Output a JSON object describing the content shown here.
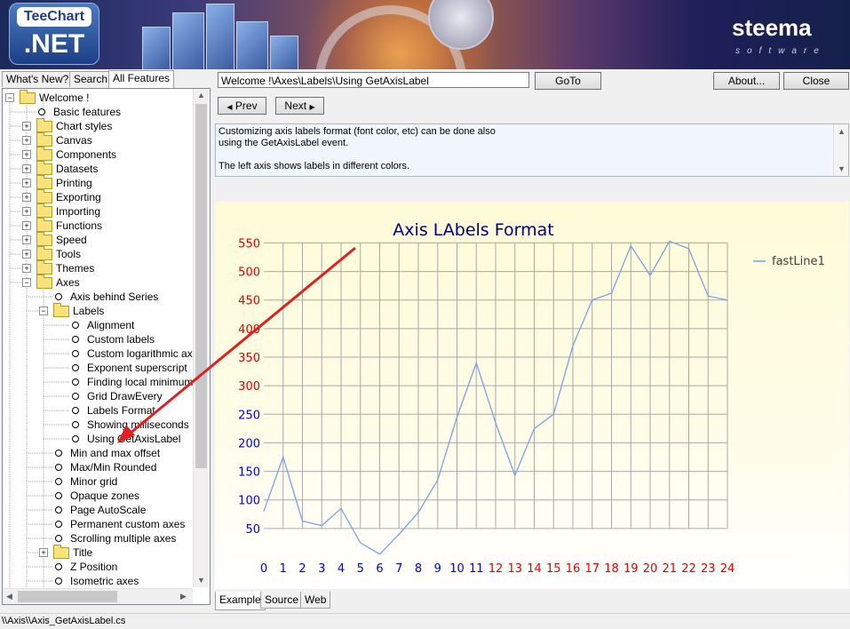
{
  "banner": {
    "logo_top": "TeeChart",
    "logo_bottom": ".NET",
    "brand": "steema",
    "brand_sub": "software"
  },
  "left_tabs": [
    "What's New?",
    "Search",
    "All Features"
  ],
  "tree": [
    {
      "label": "Welcome !",
      "depth": 0,
      "kind": "folder",
      "expander": "minus"
    },
    {
      "label": "Basic features",
      "depth": 1,
      "kind": "leaf"
    },
    {
      "label": "Chart styles",
      "depth": 1,
      "kind": "folder",
      "expander": "plus"
    },
    {
      "label": "Canvas",
      "depth": 1,
      "kind": "folder",
      "expander": "plus"
    },
    {
      "label": "Components",
      "depth": 1,
      "kind": "folder",
      "expander": "plus"
    },
    {
      "label": "Datasets",
      "depth": 1,
      "kind": "folder",
      "expander": "plus"
    },
    {
      "label": "Printing",
      "depth": 1,
      "kind": "folder",
      "expander": "plus"
    },
    {
      "label": "Exporting",
      "depth": 1,
      "kind": "folder",
      "expander": "plus"
    },
    {
      "label": "Importing",
      "depth": 1,
      "kind": "folder",
      "expander": "plus"
    },
    {
      "label": "Functions",
      "depth": 1,
      "kind": "folder",
      "expander": "plus"
    },
    {
      "label": "Speed",
      "depth": 1,
      "kind": "folder",
      "expander": "plus"
    },
    {
      "label": "Tools",
      "depth": 1,
      "kind": "folder",
      "expander": "plus"
    },
    {
      "label": "Themes",
      "depth": 1,
      "kind": "folder",
      "expander": "plus"
    },
    {
      "label": "Axes",
      "depth": 1,
      "kind": "folder",
      "expander": "minus"
    },
    {
      "label": "Axis behind Series",
      "depth": 2,
      "kind": "leaf"
    },
    {
      "label": "Labels",
      "depth": 2,
      "kind": "folder",
      "expander": "minus"
    },
    {
      "label": "Alignment",
      "depth": 3,
      "kind": "leaf"
    },
    {
      "label": "Custom labels",
      "depth": 3,
      "kind": "leaf"
    },
    {
      "label": "Custom logarithmic axis",
      "depth": 3,
      "kind": "leaf"
    },
    {
      "label": "Exponent superscript",
      "depth": 3,
      "kind": "leaf"
    },
    {
      "label": "Finding local minimum a",
      "depth": 3,
      "kind": "leaf"
    },
    {
      "label": "Grid DrawEvery",
      "depth": 3,
      "kind": "leaf"
    },
    {
      "label": "Labels Format",
      "depth": 3,
      "kind": "leaf"
    },
    {
      "label": "Showing milliseconds",
      "depth": 3,
      "kind": "leaf"
    },
    {
      "label": "Using GetAxisLabel",
      "depth": 3,
      "kind": "leaf"
    },
    {
      "label": "Min and max offset",
      "depth": 2,
      "kind": "leaf"
    },
    {
      "label": "Max/Min Rounded",
      "depth": 2,
      "kind": "leaf"
    },
    {
      "label": "Minor grid",
      "depth": 2,
      "kind": "leaf"
    },
    {
      "label": "Opaque zones",
      "depth": 2,
      "kind": "leaf"
    },
    {
      "label": "Page AutoScale",
      "depth": 2,
      "kind": "leaf"
    },
    {
      "label": "Permanent custom axes",
      "depth": 2,
      "kind": "leaf"
    },
    {
      "label": "Scrolling multiple axes",
      "depth": 2,
      "kind": "leaf"
    },
    {
      "label": "Title",
      "depth": 2,
      "kind": "folder",
      "expander": "plus"
    },
    {
      "label": "Z Position",
      "depth": 2,
      "kind": "leaf"
    },
    {
      "label": "Isometric axes",
      "depth": 2,
      "kind": "leaf"
    }
  ],
  "toolbar": {
    "path_value": "Welcome !\\Axes\\Labels\\Using GetAxisLabel",
    "goto": "GoTo",
    "about": "About...",
    "close": "Close",
    "prev": "Prev",
    "next": "Next"
  },
  "description": [
    "Customizing axis labels format (font color, etc) can be done also",
    "using the GetAxisLabel event.",
    "",
    "The left axis shows labels in different colors."
  ],
  "bottom_tabs": [
    "Example",
    "Source",
    "Web"
  ],
  "status": "\\\\Axis\\\\Axis_GetAxisLabel.cs",
  "colors": {
    "title": "#000080",
    "label_red": "#e00000",
    "label_blue": "#0000e0",
    "series": "#7aa0e8",
    "grid": "#a8a8a8",
    "annotation_arrow": "#e02020"
  },
  "chart_data": {
    "type": "line",
    "title": "Axis LAbels Format",
    "legend": [
      "fastLine1"
    ],
    "legend_position": "right",
    "grid": true,
    "x": [
      0,
      1,
      2,
      3,
      4,
      5,
      6,
      7,
      8,
      9,
      10,
      11,
      12,
      13,
      14,
      15,
      16,
      17,
      18,
      19,
      20,
      21,
      22,
      23,
      24
    ],
    "xlim": [
      0,
      24
    ],
    "ylim": [
      0,
      560
    ],
    "yticks": [
      50,
      100,
      150,
      200,
      250,
      300,
      350,
      400,
      450,
      500,
      550
    ],
    "y_tick_red_threshold": 300,
    "x_tick_red_threshold": 12,
    "series": [
      {
        "name": "fastLine1",
        "values": [
          80,
          175,
          63,
          55,
          85,
          25,
          5,
          40,
          78,
          135,
          245,
          340,
          235,
          143,
          225,
          250,
          370,
          450,
          462,
          545,
          493,
          553,
          540,
          457,
          450
        ]
      }
    ]
  }
}
